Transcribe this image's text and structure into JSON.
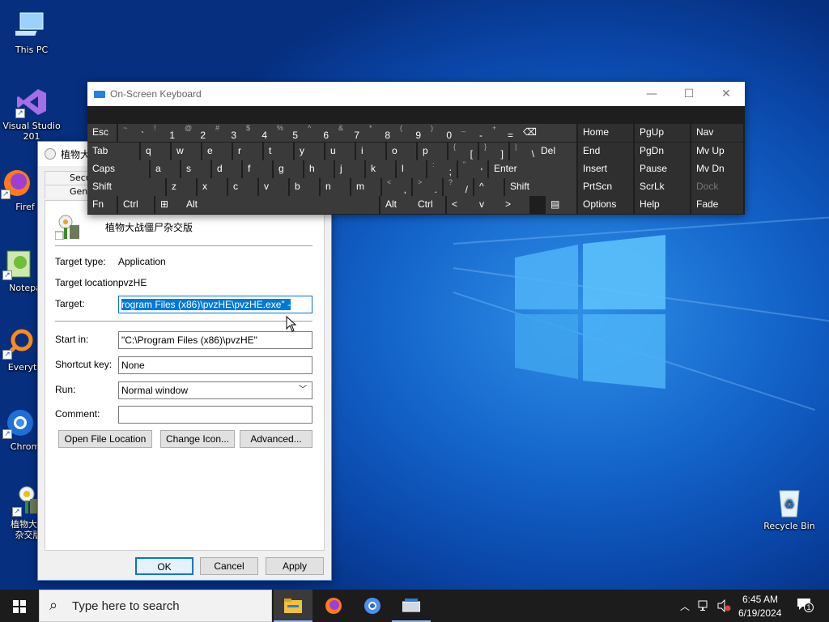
{
  "desktop": {
    "icons": [
      {
        "label": "This PC"
      },
      {
        "label": "Visual Studio 201"
      },
      {
        "label": "Firef"
      },
      {
        "label": "Notepa"
      },
      {
        "label": "Everyth"
      },
      {
        "label": "Chrom"
      },
      {
        "label": "植物大战"
      },
      {
        "label": "杂交版"
      },
      {
        "label": "Recycle Bin"
      }
    ]
  },
  "properties": {
    "title": "植物大",
    "tabs": [
      "Secu",
      "Gen"
    ],
    "app_name": "植物大战僵尸杂交版",
    "target_type_label": "Target type:",
    "target_type_value": "Application",
    "target_location_label": "Target location:",
    "target_location_value": "pvzHE",
    "target_label": "Target:",
    "target_value": "rogram Files (x86)\\pvzHE\\pvzHE.exe\" -",
    "start_in_label": "Start in:",
    "start_in_value": "\"C:\\Program Files (x86)\\pvzHE\"",
    "shortcut_key_label": "Shortcut key:",
    "shortcut_key_value": "None",
    "run_label": "Run:",
    "run_value": "Normal window",
    "comment_label": "Comment:",
    "comment_value": "",
    "open_file_location": "Open File Location",
    "change_icon": "Change Icon...",
    "advanced": "Advanced...",
    "ok": "OK",
    "cancel": "Cancel",
    "apply": "Apply"
  },
  "osk": {
    "title": "On-Screen Keyboard",
    "rows": [
      [
        {
          "m": "Esc"
        },
        {
          "s": "~",
          "b": "`"
        },
        {
          "s": "!",
          "b": "1"
        },
        {
          "s": "@",
          "b": "2"
        },
        {
          "s": "#",
          "b": "3"
        },
        {
          "s": "$",
          "b": "4"
        },
        {
          "s": "%",
          "b": "5"
        },
        {
          "s": "^",
          "b": "6"
        },
        {
          "s": "&",
          "b": "7"
        },
        {
          "s": "*",
          "b": "8"
        },
        {
          "s": "(",
          "b": "9"
        },
        {
          "s": ")",
          "b": "0"
        },
        {
          "s": "_",
          "b": "-"
        },
        {
          "s": "+",
          "b": "="
        },
        {
          "m": "⌫"
        },
        {
          "m": "Home"
        },
        {
          "m": "PgUp"
        },
        {
          "m": "Nav"
        }
      ],
      [
        {
          "m": "Tab"
        },
        {
          "m": "q"
        },
        {
          "m": "w"
        },
        {
          "m": "e"
        },
        {
          "m": "r"
        },
        {
          "m": "t"
        },
        {
          "m": "y"
        },
        {
          "m": "u"
        },
        {
          "m": "i"
        },
        {
          "m": "o"
        },
        {
          "m": "p"
        },
        {
          "s": "{",
          "b": "["
        },
        {
          "s": "}",
          "b": "]"
        },
        {
          "s": "|",
          "b": "\\"
        },
        {
          "m": "Del"
        },
        {
          "m": "End"
        },
        {
          "m": "PgDn"
        },
        {
          "m": "Mv Up"
        }
      ],
      [
        {
          "m": "Caps"
        },
        {
          "m": "a"
        },
        {
          "m": "s"
        },
        {
          "m": "d"
        },
        {
          "m": "f"
        },
        {
          "m": "g"
        },
        {
          "m": "h"
        },
        {
          "m": "j"
        },
        {
          "m": "k"
        },
        {
          "m": "l"
        },
        {
          "s": ":",
          "b": ";"
        },
        {
          "s": "\"",
          "b": "'"
        },
        {
          "m": "Enter"
        },
        {
          "m": "Insert"
        },
        {
          "m": "Pause"
        },
        {
          "m": "Mv Dn"
        }
      ],
      [
        {
          "m": "Shift"
        },
        {
          "m": "z"
        },
        {
          "m": "x"
        },
        {
          "m": "c"
        },
        {
          "m": "v"
        },
        {
          "m": "b"
        },
        {
          "m": "n"
        },
        {
          "m": "m"
        },
        {
          "s": "<",
          "b": ","
        },
        {
          "s": ">",
          "b": "."
        },
        {
          "s": "?",
          "b": "/"
        },
        {
          "m": "^"
        },
        {
          "m": "Shift"
        },
        {
          "m": "PrtScn"
        },
        {
          "m": "ScrLk"
        },
        {
          "m": "Dock"
        }
      ],
      [
        {
          "m": "Fn"
        },
        {
          "m": "Ctrl"
        },
        {
          "m": "⊞"
        },
        {
          "m": "Alt"
        },
        {
          "m": ""
        },
        {
          "m": "Alt"
        },
        {
          "m": "Ctrl"
        },
        {
          "m": "<"
        },
        {
          "m": "v"
        },
        {
          "m": ">"
        },
        {
          "m": "▤"
        },
        {
          "m": "Options"
        },
        {
          "m": "Help"
        },
        {
          "m": "Fade"
        }
      ]
    ]
  },
  "taskbar": {
    "search_placeholder": "Type here to search",
    "time": "6:45 AM",
    "date": "6/19/2024",
    "notifications": "1"
  }
}
